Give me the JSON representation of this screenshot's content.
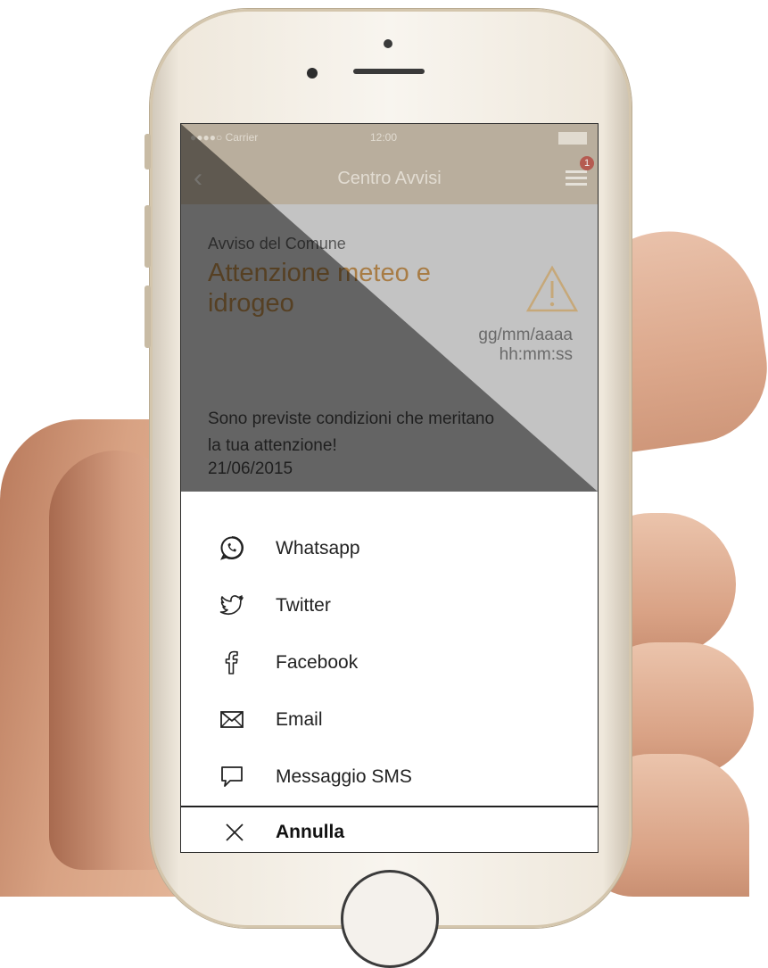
{
  "statusbar": {
    "carrier": "●●●●○ Carrier",
    "time": "12:00"
  },
  "navbar": {
    "title": "Centro Avvisi",
    "back_icon": "chevron-left-icon",
    "menu_icon": "hamburger-menu-icon",
    "badge_count": "1"
  },
  "notice": {
    "source": "Avviso del Comune",
    "title": "Attenzione meteo e idrogeo",
    "date_placeholder": "gg/mm/aaaa",
    "time_placeholder": "hh:mm:ss",
    "body": "Sono previste condizioni che meritano la tua attenzione!",
    "body_date": "21/06/2015",
    "warning_icon": "warning-triangle-icon"
  },
  "share_sheet": {
    "items": [
      {
        "label": "Whatsapp",
        "icon": "whatsapp-icon"
      },
      {
        "label": "Twitter",
        "icon": "twitter-icon"
      },
      {
        "label": "Facebook",
        "icon": "facebook-icon"
      },
      {
        "label": "Email",
        "icon": "email-icon"
      },
      {
        "label": "Messaggio SMS",
        "icon": "sms-icon"
      }
    ],
    "cancel_label": "Annulla",
    "cancel_icon": "close-icon"
  },
  "colors": {
    "navbar": "#b7a992",
    "title_accent": "#a0661c",
    "badge": "#b23a2c"
  }
}
